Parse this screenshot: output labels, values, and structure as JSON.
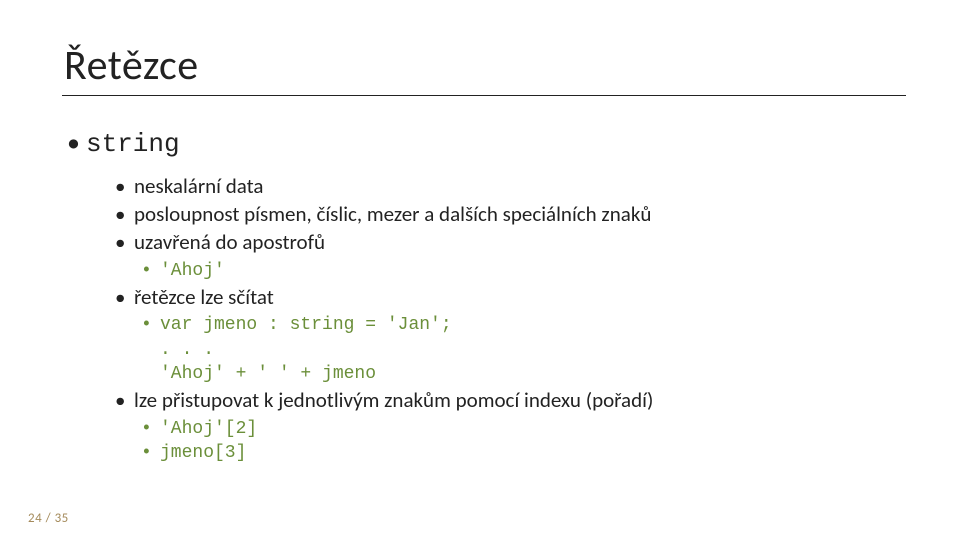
{
  "title": "Řetězce",
  "bullet1": "string",
  "sub": {
    "a": "neskalární data",
    "b": "posloupnost písmen, číslic, mezer a dalších speciálních znaků",
    "c": "uzavřená do apostrofů",
    "c_ex": "'Ahoj'",
    "d": "řetězce lze sčítat",
    "d_ex1": "var jmeno : string = 'Jan';",
    "d_ex2": ". . .",
    "d_ex3": "'Ahoj' + ' ' + jmeno",
    "e": "lze přistupovat k jednotlivým znakům pomocí indexu (pořadí)",
    "e_ex1": "'Ahoj'[2]",
    "e_ex2": "jmeno[3]"
  },
  "footer": {
    "page": "24",
    "sep": " / ",
    "total": "35"
  }
}
